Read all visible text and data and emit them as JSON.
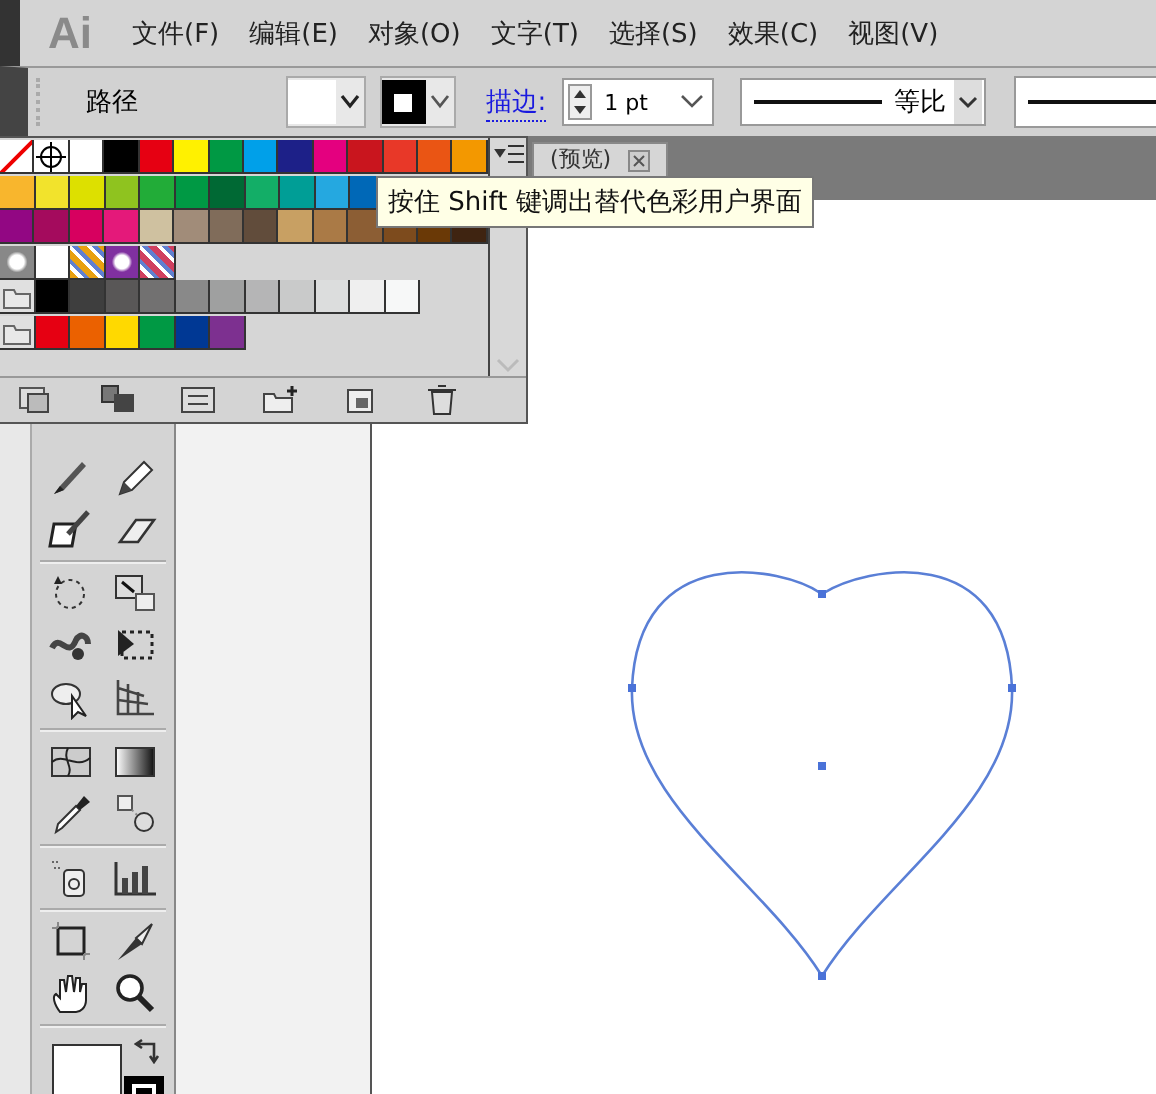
{
  "app_logo": "Ai",
  "menu": [
    "文件(F)",
    "编辑(E)",
    "对象(O)",
    "文字(T)",
    "选择(S)",
    "效果(C)",
    "视图(V)"
  ],
  "control_bar": {
    "object_type": "路径",
    "stroke_label": "描边:",
    "stroke_weight": "1 pt",
    "profile": "等比"
  },
  "document_tab": {
    "title": "(预览)"
  },
  "swatches": {
    "rows": [
      [
        {
          "kind": "none"
        },
        {
          "kind": "registration"
        },
        {
          "kind": "color",
          "color": "#ffffff"
        },
        {
          "kind": "color",
          "color": "#000000"
        },
        {
          "kind": "color",
          "color": "#e60012"
        },
        {
          "kind": "color",
          "color": "#fff100"
        },
        {
          "kind": "color",
          "color": "#009944"
        },
        {
          "kind": "color",
          "color": "#00a0e9"
        },
        {
          "kind": "color",
          "color": "#1d2088"
        },
        {
          "kind": "color",
          "color": "#e4007f"
        },
        {
          "kind": "color",
          "color": "#c9151e"
        },
        {
          "kind": "color",
          "color": "#e83828"
        },
        {
          "kind": "color",
          "color": "#ea5514"
        },
        {
          "kind": "color",
          "color": "#f39800"
        }
      ],
      [
        {
          "kind": "color",
          "color": "#f8b62d"
        },
        {
          "kind": "color",
          "color": "#f2e32c"
        },
        {
          "kind": "color",
          "color": "#dde000"
        },
        {
          "kind": "color",
          "color": "#8fc31f"
        },
        {
          "kind": "color",
          "color": "#22ac38"
        },
        {
          "kind": "color",
          "color": "#009944"
        },
        {
          "kind": "color",
          "color": "#006934"
        },
        {
          "kind": "color",
          "color": "#13ae67"
        },
        {
          "kind": "color",
          "color": "#009e96"
        },
        {
          "kind": "color",
          "color": "#25a8e0"
        },
        {
          "kind": "color",
          "color": "#0068b7"
        }
      ],
      [
        {
          "kind": "color",
          "color": "#920783"
        },
        {
          "kind": "color",
          "color": "#a40b5d"
        },
        {
          "kind": "color",
          "color": "#d7005f"
        },
        {
          "kind": "color",
          "color": "#e4197a"
        },
        {
          "kind": "color",
          "color": "#cfc1a0"
        },
        {
          "kind": "color",
          "color": "#a18c79"
        },
        {
          "kind": "color",
          "color": "#806c5a"
        },
        {
          "kind": "color",
          "color": "#614c3b"
        },
        {
          "kind": "color",
          "color": "#c8a063"
        },
        {
          "kind": "color",
          "color": "#aa7a46"
        },
        {
          "kind": "color",
          "color": "#8c5e34"
        },
        {
          "kind": "color",
          "color": "#7d4b1d"
        },
        {
          "kind": "color",
          "color": "#6a3906"
        },
        {
          "kind": "color",
          "color": "#3f2411"
        }
      ],
      [
        {
          "kind": "gradient",
          "color": "#888888"
        },
        {
          "kind": "gradient",
          "color": "#ffffff"
        },
        {
          "kind": "pattern",
          "color": "#e8a010"
        },
        {
          "kind": "gradient",
          "color": "#8030a0"
        },
        {
          "kind": "pattern",
          "color": "#d04060"
        }
      ],
      [
        {
          "kind": "folder"
        },
        {
          "kind": "color",
          "color": "#000000"
        },
        {
          "kind": "color",
          "color": "#3e3e3e"
        },
        {
          "kind": "color",
          "color": "#595757"
        },
        {
          "kind": "color",
          "color": "#727171"
        },
        {
          "kind": "color",
          "color": "#898989"
        },
        {
          "kind": "color",
          "color": "#9fa0a0"
        },
        {
          "kind": "color",
          "color": "#b5b5b6"
        },
        {
          "kind": "color",
          "color": "#c9caca"
        },
        {
          "kind": "color",
          "color": "#dcdddd"
        },
        {
          "kind": "color",
          "color": "#efefef"
        },
        {
          "kind": "color",
          "color": "#f7f8f8"
        }
      ],
      [
        {
          "kind": "folder"
        },
        {
          "kind": "color",
          "color": "#e60012"
        },
        {
          "kind": "color",
          "color": "#eb6100"
        },
        {
          "kind": "color",
          "color": "#ffd900"
        },
        {
          "kind": "color",
          "color": "#009944"
        },
        {
          "kind": "color",
          "color": "#003894"
        },
        {
          "kind": "color",
          "color": "#7d3090"
        }
      ]
    ]
  },
  "tooltip": "按住 Shift 键调出替代色彩用户界面"
}
